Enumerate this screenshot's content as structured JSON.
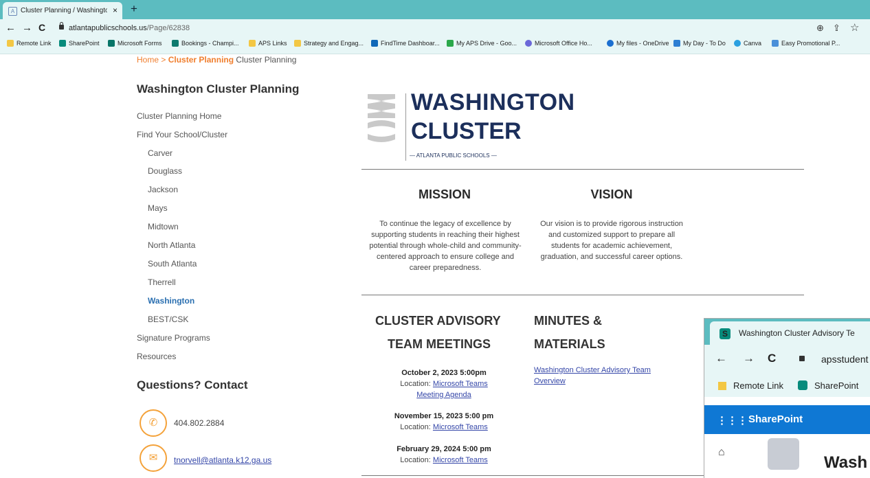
{
  "browser": {
    "tab_title": "Cluster Planning / Washington C",
    "tab_close": "×",
    "new_tab": "+",
    "url_host": "atlantapublicschools.us",
    "url_path": "/Page/62838",
    "back": "←",
    "forward": "→",
    "reload": "C",
    "zoom_icon": "⊕",
    "share_icon": "⇪",
    "star_icon": "☆",
    "bookmarks": [
      "Remote Link",
      "SharePoint",
      "Microsoft Forms",
      "Bookings - Champi...",
      "APS Links",
      "Strategy and Engag...",
      "FindTime Dashboar...",
      "My APS Drive - Goo...",
      "Microsoft Office Ho...",
      "My files - OneDrive",
      "My Day - To Do",
      "Canva",
      "Easy Promotional P..."
    ]
  },
  "breadcrumb": {
    "home": "Home",
    "sep": ">",
    "section": "Cluster Planning",
    "current": "Cluster Planning"
  },
  "sidebar": {
    "heading": "Washington Cluster Planning",
    "items": [
      "Cluster Planning Home",
      "Find Your School/Cluster",
      "Carver",
      "Douglass",
      "Jackson",
      "Mays",
      "Midtown",
      "North Atlanta",
      "South Atlanta",
      "Therrell",
      "Washington",
      "BEST/CSK",
      "Signature Programs",
      "Resources"
    ],
    "contact_heading": "Questions? Contact",
    "phone": "404.802.2884",
    "email": "tnorvell@atlanta.k12.ga.us"
  },
  "logo": {
    "mark": "WC",
    "line1": "WASHINGTON",
    "line2": "CLUSTER",
    "line3": "— ATLANTA PUBLIC SCHOOLS —"
  },
  "mission": {
    "heading": "MISSION",
    "text": "To continue the legacy of excellence by supporting students in reaching their highest potential through whole-child and community-centered approach to ensure college and career preparedness."
  },
  "vision": {
    "heading": "VISION",
    "text": "Our vision is to provide rigorous instruction and customized support to prepare all students for academic achievement, graduation, and successful career options."
  },
  "meetings": {
    "heading_line1": "CLUSTER ADVISORY",
    "heading_line2": "TEAM MEETINGS",
    "location_label": "Location:",
    "items": [
      {
        "date": "October 2, 2023 5:00pm",
        "location": "Microsoft Teams",
        "extra": "Meeting Agenda"
      },
      {
        "date": "November 15, 2023 5:00 pm",
        "location": "Microsoft Teams"
      },
      {
        "date": "February 29, 2024 5:00 pm",
        "location": "Microsoft Teams"
      }
    ]
  },
  "materials": {
    "heading_line1": "MINUTES &",
    "heading_line2": "MATERIALS",
    "link": "Washington Cluster Advisory Team Overview"
  },
  "overlay": {
    "tab_title": "Washington Cluster Advisory Te",
    "url": "apsstudent",
    "bookmark1": "Remote Link",
    "bookmark2": "SharePoint",
    "app_name": "SharePoint",
    "site_title": "Wash",
    "grid_icon": "⋮⋮⋮",
    "home_icon": "⌂"
  },
  "colors": {
    "accent": "#f07e2d",
    "active_link": "#2a6fb0",
    "chrome": "#5cbcc0",
    "logo_navy": "#1c2f5b",
    "sharepoint_blue": "#0f78d4"
  }
}
